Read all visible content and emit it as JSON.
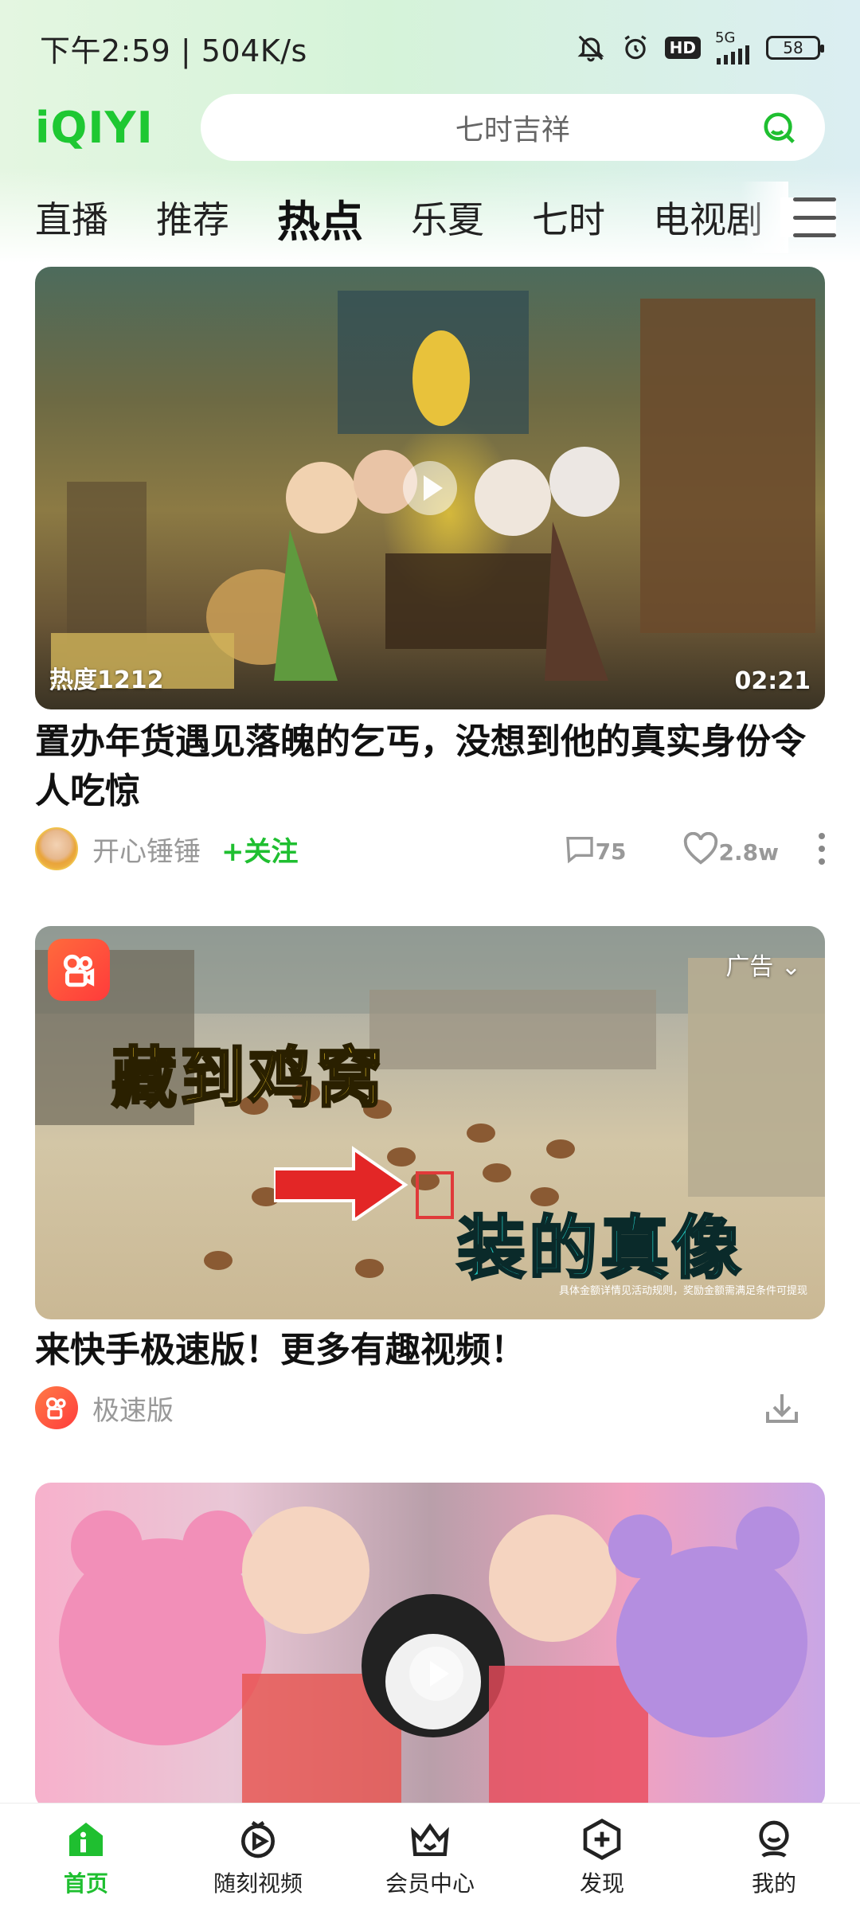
{
  "status_bar": {
    "time_speed": "下午2:59 | 504K/s",
    "network": "5G",
    "hd": "HD",
    "battery": "58"
  },
  "header": {
    "logo": "iQIYI",
    "search_placeholder": "七时吉祥"
  },
  "tabs": [
    {
      "label": "直播",
      "active": false
    },
    {
      "label": "推荐",
      "active": false
    },
    {
      "label": "热点",
      "active": true
    },
    {
      "label": "乐夏",
      "active": false
    },
    {
      "label": "七时",
      "active": false
    },
    {
      "label": "电视剧",
      "active": false
    }
  ],
  "feed": [
    {
      "heat": "热度1212",
      "duration": "02:21",
      "title": "置办年货遇见落魄的乞丐，没想到他的真实身份令人吃惊",
      "author": "开心锤锤",
      "follow": "+关注",
      "comments": "75",
      "likes": "2.8w"
    },
    {
      "ad_label": "广告",
      "overlay_text_1": "藏到鸡窝",
      "overlay_text_2": "装的真像",
      "fine_print": "具体金额详情见活动规则，奖励金额需满足条件可提现",
      "title": "来快手极速版！更多有趣视频！",
      "source": "极速版"
    },
    {
      "title": ""
    }
  ],
  "bottom_nav": [
    {
      "label": "首页",
      "icon": "home-icon",
      "active": true
    },
    {
      "label": "随刻视频",
      "icon": "play-circle-icon",
      "active": false
    },
    {
      "label": "会员中心",
      "icon": "crown-icon",
      "active": false
    },
    {
      "label": "发现",
      "icon": "discover-plus-icon",
      "active": false
    },
    {
      "label": "我的",
      "icon": "profile-icon",
      "active": false
    }
  ],
  "colors": {
    "brand_green": "#1fbf30",
    "text_primary": "#111111",
    "text_secondary": "#999999"
  }
}
